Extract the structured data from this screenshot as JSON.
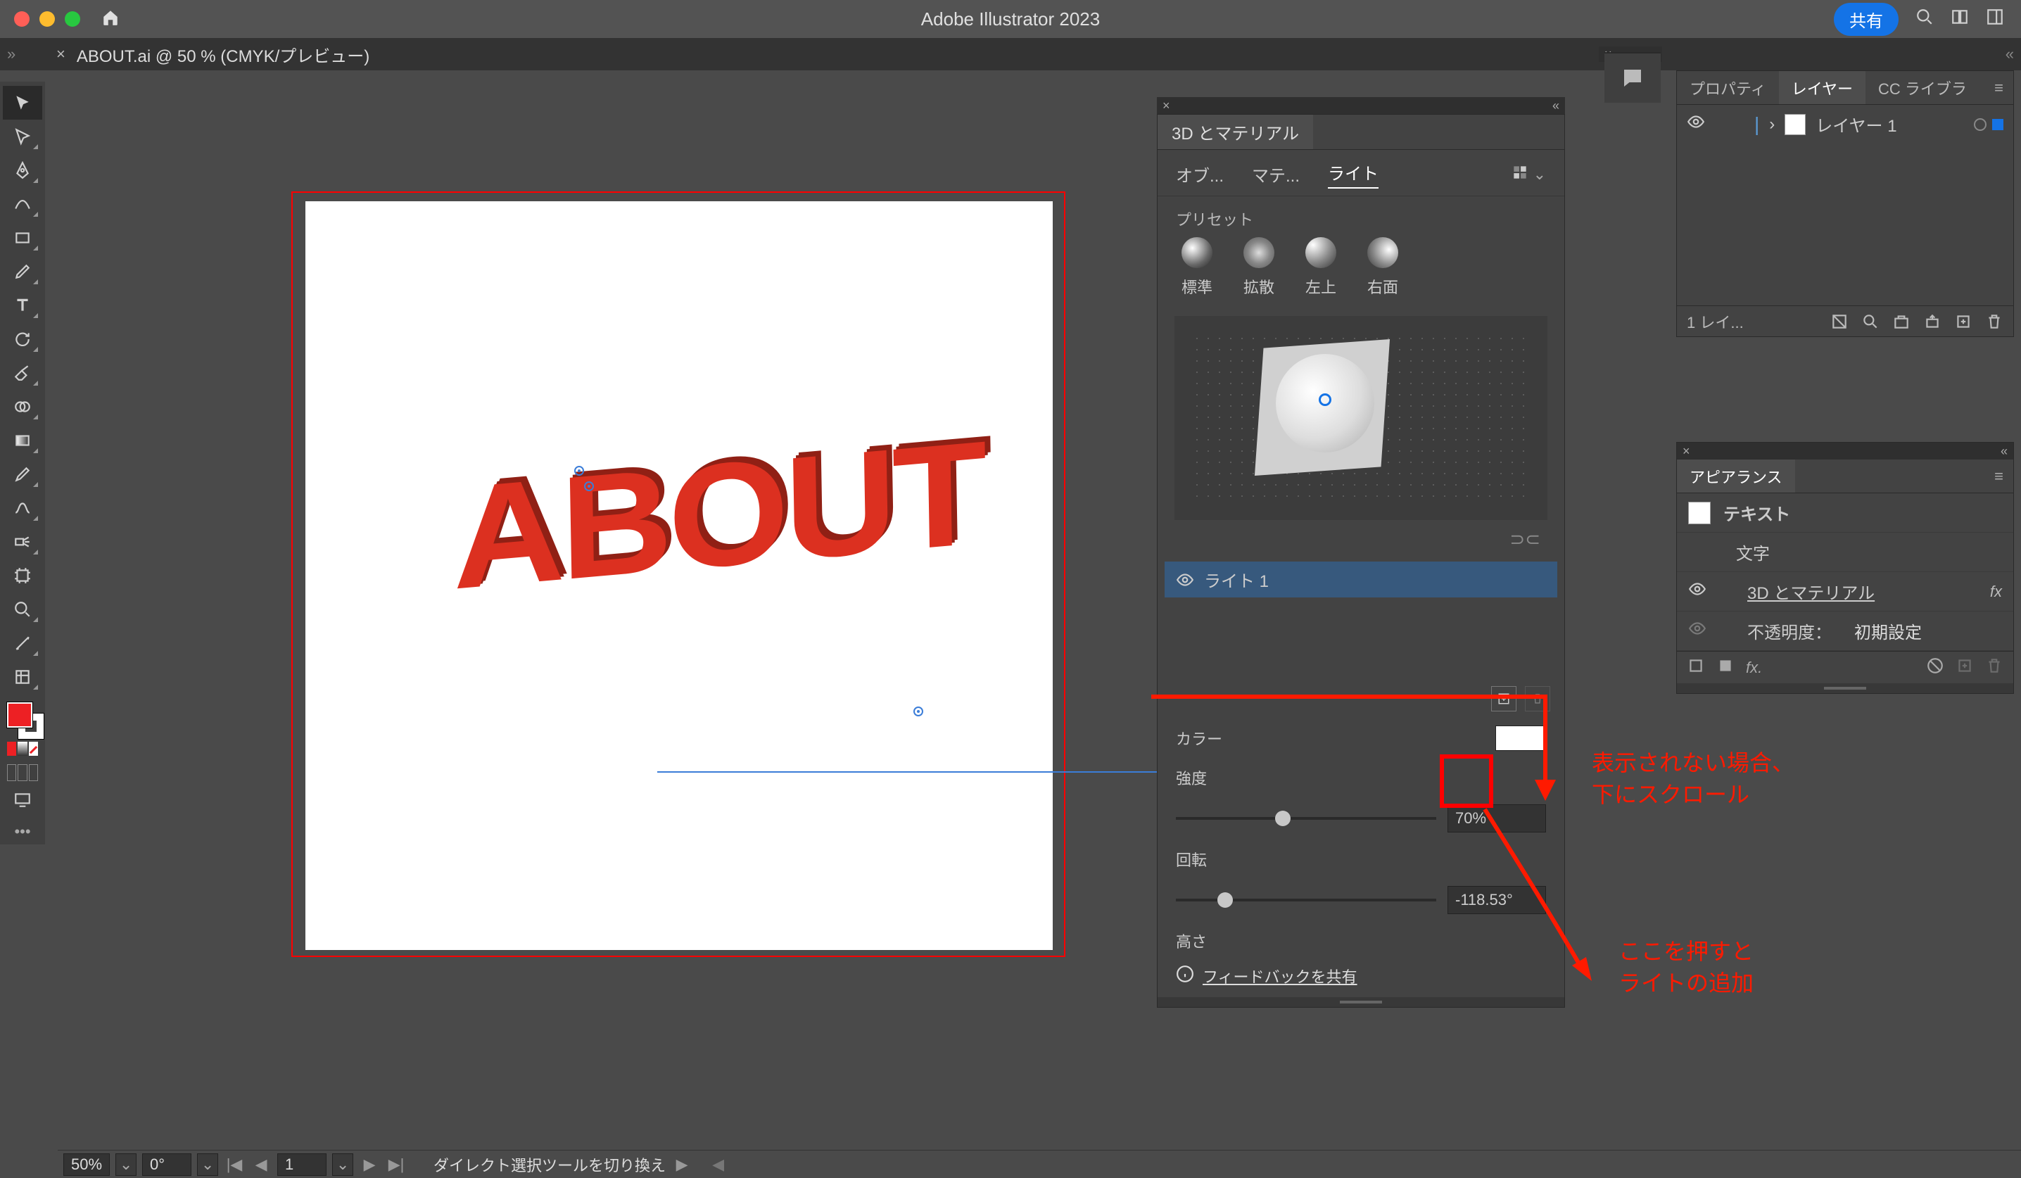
{
  "titlebar": {
    "app_title": "Adobe Illustrator 2023",
    "share_label": "共有"
  },
  "doc_tab": {
    "label": "ABOUT.ai @ 50 % (CMYK/プレビュー)"
  },
  "canvas": {
    "main_text": "ABOUT"
  },
  "panel3d": {
    "title": "3D とマテリアル",
    "subtabs": {
      "object": "オブ...",
      "material": "マテ...",
      "light": "ライト"
    },
    "preset_label": "プリセット",
    "presets": {
      "standard": "標準",
      "diffuse": "拡散",
      "topleft": "左上",
      "right": "右面"
    },
    "light_list": {
      "light1": "ライト 1"
    },
    "props": {
      "color_label": "カラー",
      "intensity_label": "強度",
      "intensity_value": "70%",
      "rotation_label": "回転",
      "rotation_value": "-118.53°",
      "height_label": "高さ"
    },
    "feedback": "フィードバックを共有"
  },
  "right_panel1": {
    "tabs": {
      "properties": "プロパティ",
      "layers": "レイヤー",
      "cclib": "CC ライブラ"
    },
    "layer1_name": "レイヤー 1",
    "footer_count": "1 レイ..."
  },
  "appearance": {
    "title": "アピアランス",
    "rows": {
      "text": "テキスト",
      "char": "文字",
      "threeD": "3D とマテリアル",
      "opacity_label": "不透明度：",
      "opacity_value": "初期設定"
    }
  },
  "annotations": {
    "scroll_note_l1": "表示されない場合、",
    "scroll_note_l2": "下にスクロール",
    "add_note_l1": "ここを押すと",
    "add_note_l2": "ライトの追加"
  },
  "statusbar": {
    "zoom": "50%",
    "rotation": "0°",
    "page": "1",
    "hint": "ダイレクト選択ツールを切り換え"
  }
}
